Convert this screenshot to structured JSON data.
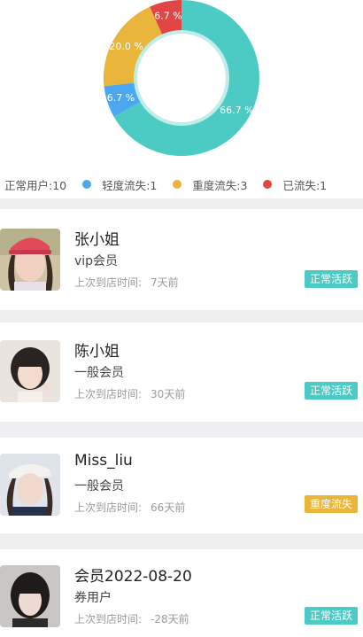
{
  "chart_data": {
    "type": "pie",
    "title": "",
    "slices": [
      {
        "label": "正常用户",
        "value": 10,
        "percent_label": "66.7 %",
        "color": "#4ccbc4"
      },
      {
        "label": "轻度流失",
        "value": 1,
        "percent_label": "6.7 %",
        "color": "#4aa8f0"
      },
      {
        "label": "重度流失",
        "value": 3,
        "percent_label": "20.0 %",
        "color": "#e9b53a"
      },
      {
        "label": "已流失",
        "value": 1,
        "percent_label": "6.7 %",
        "color": "#e04646"
      }
    ],
    "legend_position": "bottom"
  },
  "legend": {
    "items": [
      {
        "text": "正常用户:10",
        "color": "#4ccbc4"
      },
      {
        "text": "轻度流失:1",
        "color": "#4aa8f0"
      },
      {
        "text": "重度流失:3",
        "color": "#e9b53a"
      },
      {
        "text": "已流失:1",
        "color": "#e04646"
      }
    ]
  },
  "customers": [
    {
      "name": "张小姐",
      "level": "vip会员",
      "visit_label": "上次到店时间:",
      "visit_value": "7天前",
      "status": "正常活跃"
    },
    {
      "name": "陈小姐",
      "level": "一般会员",
      "visit_label": "上次到店时间:",
      "visit_value": "30天前",
      "status": "正常活跃"
    },
    {
      "name": "Miss_liu",
      "level": "一般会员",
      "visit_label": "上次到店时间:",
      "visit_value": "66天前",
      "status": "重度流失"
    },
    {
      "name": "会员2022-08-20",
      "level": "券用户",
      "visit_label": "上次到店时间:",
      "visit_value": "-28天前",
      "status": "正常活跃"
    }
  ],
  "colors": {
    "active_badge": "#4ccbc4",
    "heavy_badge": "#e9b53a",
    "separator": "#efeff1"
  }
}
